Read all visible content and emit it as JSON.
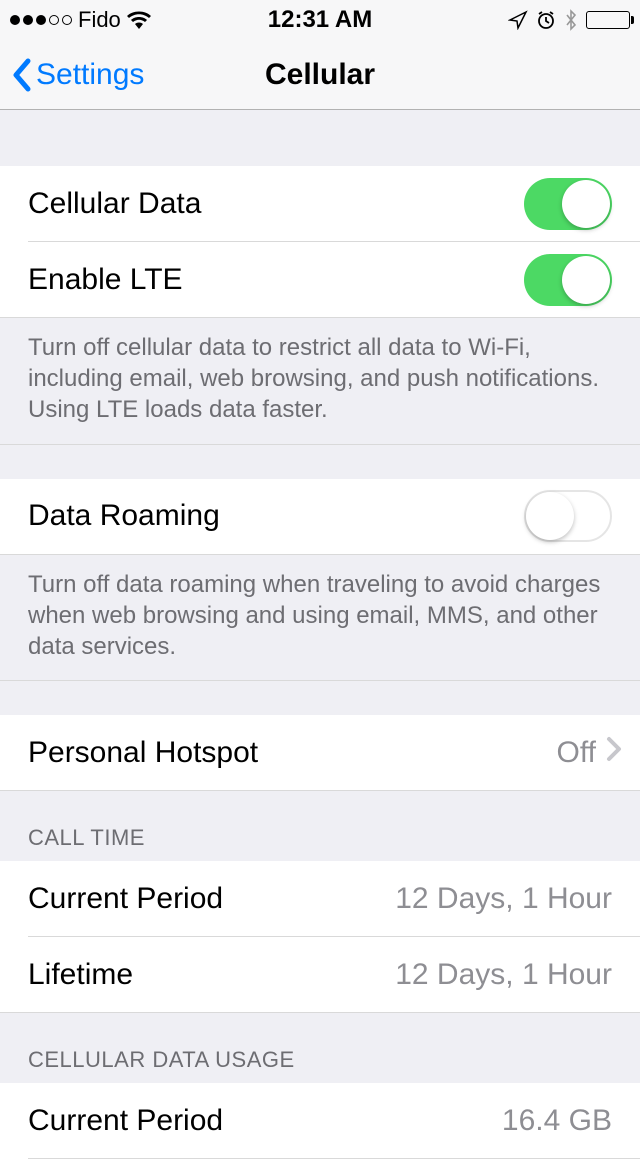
{
  "status": {
    "carrier": "Fido",
    "time": "12:31 AM"
  },
  "nav": {
    "back_label": "Settings",
    "title": "Cellular"
  },
  "section1": {
    "cellular_data_label": "Cellular Data",
    "enable_lte_label": "Enable LTE",
    "footer": "Turn off cellular data to restrict all data to Wi-Fi, including email, web browsing, and push notifications. Using LTE loads data faster."
  },
  "section2": {
    "data_roaming_label": "Data Roaming",
    "footer": "Turn off data roaming when traveling to avoid charges when web browsing and using email, MMS, and other data services."
  },
  "section3": {
    "personal_hotspot_label": "Personal Hotspot",
    "personal_hotspot_value": "Off"
  },
  "call_time": {
    "header": "CALL TIME",
    "current_period_label": "Current Period",
    "current_period_value": "12 Days, 1 Hour",
    "lifetime_label": "Lifetime",
    "lifetime_value": "12 Days, 1 Hour"
  },
  "data_usage": {
    "header": "CELLULAR DATA USAGE",
    "current_period_label": "Current Period",
    "current_period_value": "16.4 GB"
  }
}
